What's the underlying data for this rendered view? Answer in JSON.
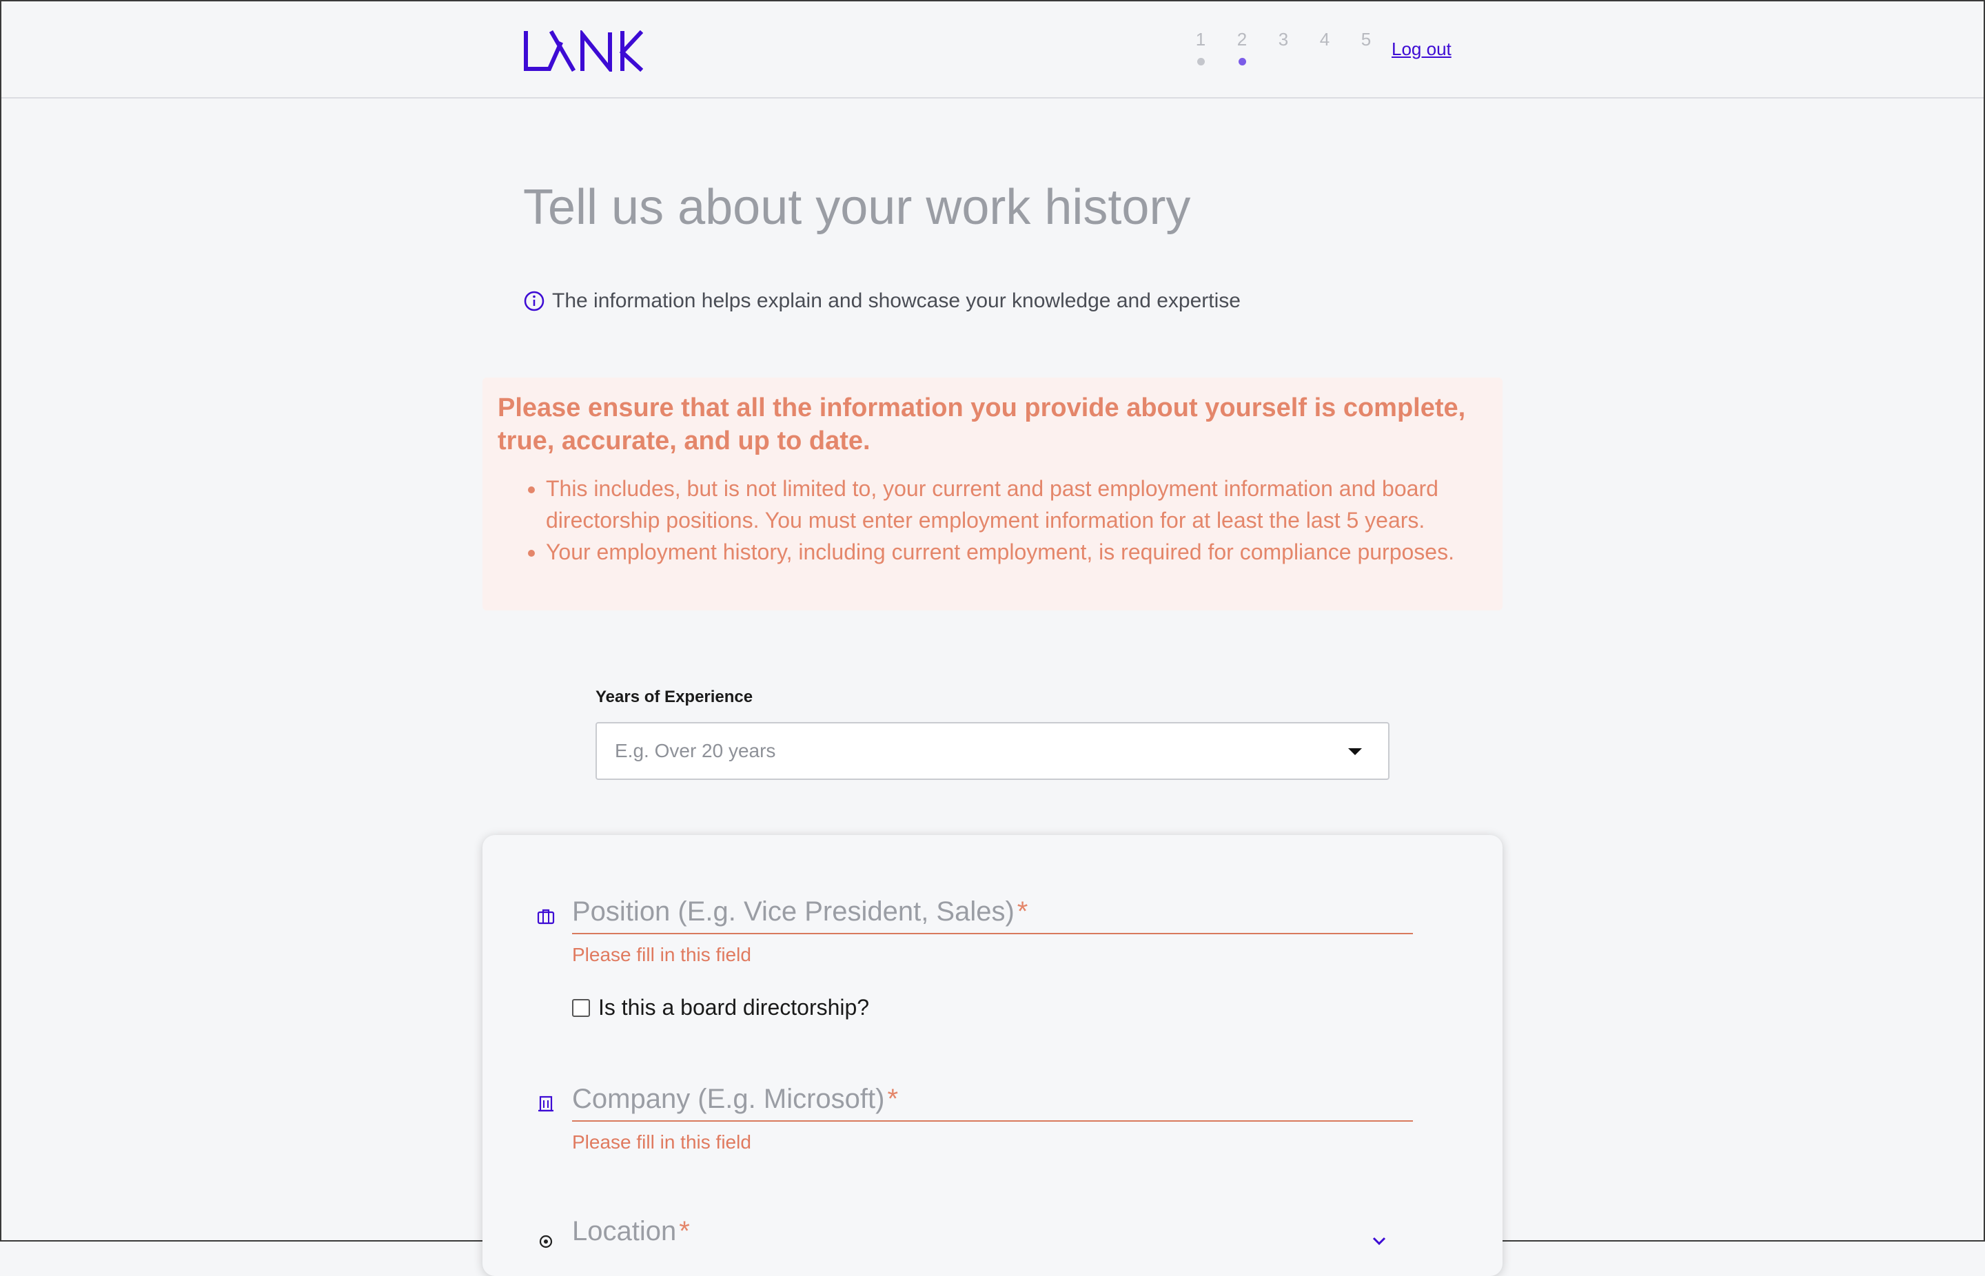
{
  "colors": {
    "brand": "#3d0bd4",
    "warning_text": "#e4866a",
    "warning_bg": "#fcf1ef",
    "error": "#e07a5f",
    "step_active_dot": "#7b5ce8",
    "step_inactive_dot": "#c4c6cc"
  },
  "header": {
    "logo_icon": "lynk-logo-icon",
    "steps": [
      {
        "label": "1",
        "dot": "#c4c6cc"
      },
      {
        "label": "2",
        "dot": "#7b5ce8"
      },
      {
        "label": "3",
        "dot": ""
      },
      {
        "label": "4",
        "dot": ""
      },
      {
        "label": "5",
        "dot": ""
      }
    ],
    "current_step": 2,
    "logout_label": "Log out"
  },
  "main": {
    "title": "Tell us about your work history",
    "info_icon": "info-icon",
    "info_text": "The information helps explain and showcase your knowledge and expertise",
    "warning": {
      "title": "Please ensure that all the information you provide about yourself is complete, true, accurate, and up to date.",
      "items": [
        "This includes, but is not limited to, your current and past employment information and board directorship positions. You must enter employment information for at least the last 5 years.",
        "Your employment history, including current employment, is required for compliance purposes."
      ]
    },
    "years": {
      "label": "Years of Experience",
      "placeholder": "E.g. Over 20 years",
      "caret_icon": "caret-down-icon"
    }
  },
  "form": {
    "position": {
      "icon": "briefcase-icon",
      "placeholder": "Position (E.g. Vice President, Sales)",
      "required_mark": "*",
      "error": "Please fill in this field"
    },
    "board_checkbox": {
      "label": "Is this a board directorship?",
      "checked": false
    },
    "company": {
      "icon": "building-icon",
      "placeholder": "Company (E.g. Microsoft)",
      "required_mark": "*",
      "error": "Please fill in this field"
    },
    "location": {
      "icon": "location-pin-icon",
      "placeholder": "Location",
      "required_mark": "*",
      "chevron_icon": "chevron-down-icon"
    }
  }
}
